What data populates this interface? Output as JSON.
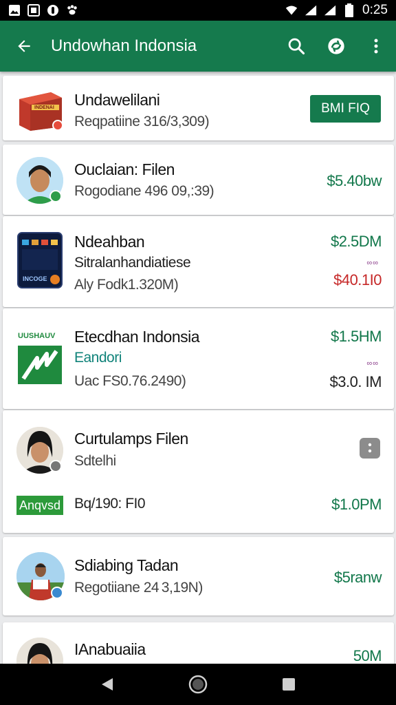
{
  "status_bar": {
    "time": "0:25",
    "left_icons": [
      "image-icon",
      "photo-icon",
      "circle-letter-icon",
      "paw-icon"
    ],
    "right_icons": [
      "wifi-icon",
      "signal-icon",
      "signal-icon",
      "battery-icon"
    ]
  },
  "app_bar": {
    "title": "Undowhan Indonsia",
    "icons": [
      "back-arrow-icon",
      "search-icon",
      "sync-icon",
      "more-vert-icon"
    ]
  },
  "items": [
    {
      "name": "Undawelilani",
      "line1": "Reqpatiine 316/3,309)",
      "button": "BMI FIQ",
      "thumb": "package-box-icon",
      "thumb_text": "INDENAI"
    },
    {
      "name": "Ouclaian: Filen",
      "line1": "Rogodiane 496 09,:39)",
      "price1": "$5.40bw",
      "thumb": "person-avatar"
    },
    {
      "name": "Ndeahban",
      "line1": "Sitralanhandiatiese",
      "line2": "Aly Fodk1.320M)",
      "price1": "$2.5DM",
      "eye": "∞∞",
      "price2": "$40.1I0",
      "thumb": "phone-app-icon",
      "thumb_text": "INCOGE"
    },
    {
      "name": "Etecdhan Indonsia",
      "line1": "Eandori",
      "line2": "Uac FS0.76.2490)",
      "price1": "$1.5HM",
      "eye": "∞∞",
      "price2": "$3.0. IM",
      "thumb": "green-logo-icon",
      "thumb_text": "UUSHAUV"
    },
    {
      "name": "Curtulamps Filen",
      "line1": "Sdtelhi",
      "line2": "Bq/190: FI0",
      "tag": "Anqvsd",
      "price1": "$1.0PM",
      "thumb": "person-avatar"
    },
    {
      "name": "Sdiabing Tadan",
      "line1": "Regotiiane 24 3,19N)",
      "price1": "$5ranw",
      "thumb": "person-avatar"
    },
    {
      "name": "IAnabuaiia",
      "price1": "50M",
      "thumb": "person-avatar"
    }
  ],
  "nav_bar": {
    "icons": [
      "back-triangle-icon",
      "home-circle-icon",
      "recents-square-icon"
    ]
  },
  "colors": {
    "primary": "#157a4d",
    "price_green": "#11774a",
    "price_red": "#c62828",
    "teal_text": "#11837a"
  }
}
